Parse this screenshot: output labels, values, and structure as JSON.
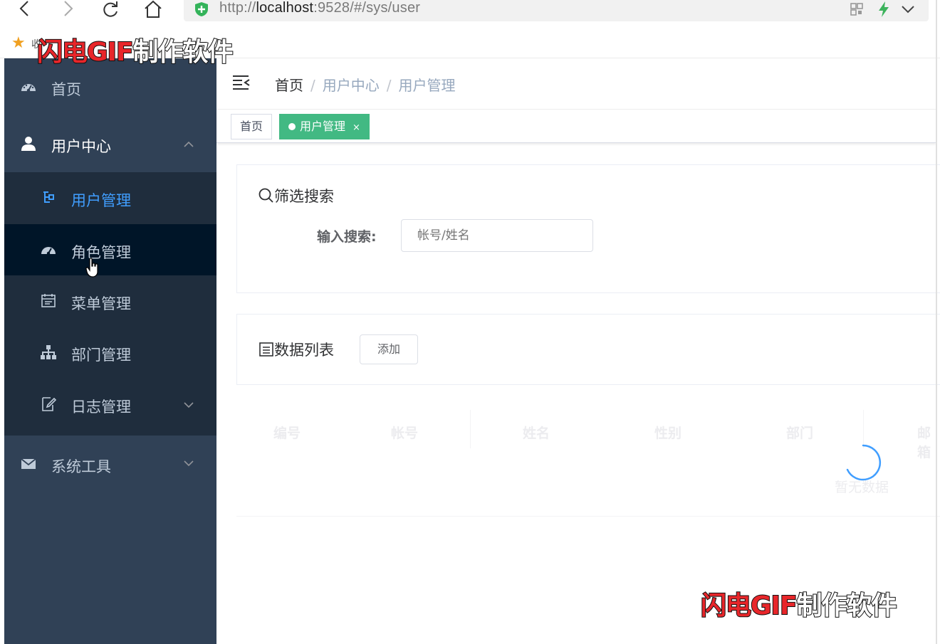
{
  "browser": {
    "url_prefix": "http://",
    "url_host": "localhost",
    "url_rest": ":9528/#/sys/user",
    "bookmark_text": "收"
  },
  "watermark": {
    "part1": "闪电GIF",
    "part2": "制作软件"
  },
  "sidebar": {
    "items": [
      {
        "label": "首页",
        "icon": "dashboard-icon"
      },
      {
        "label": "用户中心",
        "icon": "user-icon",
        "expanded": true
      },
      {
        "label": "系统工具",
        "icon": "mail-icon",
        "expanded": false
      }
    ],
    "submenu": [
      {
        "label": "用户管理",
        "icon": "tree-icon",
        "active": true
      },
      {
        "label": "角色管理",
        "icon": "dashboard-icon"
      },
      {
        "label": "菜单管理",
        "icon": "calendar-icon"
      },
      {
        "label": "部门管理",
        "icon": "org-icon"
      },
      {
        "label": "日志管理",
        "icon": "edit-icon",
        "expanded": false
      }
    ]
  },
  "breadcrumb": [
    "首页",
    "用户中心",
    "用户管理"
  ],
  "breadcrumb_sep": "/",
  "tags": [
    {
      "label": "首页"
    },
    {
      "label": "用户管理",
      "active": true,
      "close": "×"
    }
  ],
  "search_card": {
    "title": "筛选搜索",
    "label": "输入搜索:",
    "placeholder": "帐号/姓名"
  },
  "list_card": {
    "title": "数据列表",
    "add_button": "添加"
  },
  "table": {
    "columns": [
      "编号",
      "帐号",
      "姓名",
      "性别",
      "部门",
      "邮箱"
    ],
    "empty_text": "暂无数据",
    "loading": true
  },
  "colors": {
    "sidebar_bg": "#304156",
    "submenu_bg": "#1f2d3d",
    "active_text": "#409eff",
    "tag_active": "#42b983"
  }
}
